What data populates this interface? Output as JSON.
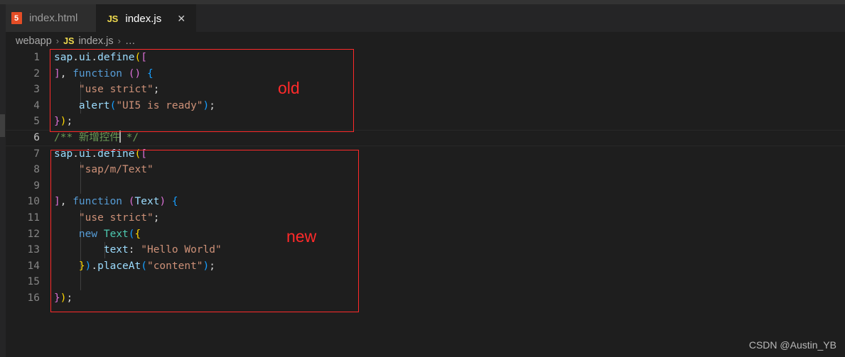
{
  "window": {
    "background": "#1e1e1e",
    "accent_red": "#ff2a2a"
  },
  "tabs": [
    {
      "label": "index.html",
      "icon": "html5-file-icon",
      "icon_glyph": "5",
      "active": false,
      "closable": false
    },
    {
      "label": "index.js",
      "icon": "javascript-file-icon",
      "icon_glyph": "JS",
      "active": true,
      "closable": true,
      "close_glyph": "✕"
    }
  ],
  "breadcrumb": {
    "root": "webapp",
    "separator": "›",
    "file_icon": "JS",
    "file": "index.js",
    "more": "…"
  },
  "editor": {
    "language": "javascript",
    "active_line": 6,
    "lines": [
      {
        "n": "1",
        "active": false,
        "guides": []
      },
      {
        "n": "2",
        "active": false,
        "guides": []
      },
      {
        "n": "3",
        "active": false,
        "guides": [
          "g1"
        ]
      },
      {
        "n": "4",
        "active": false,
        "guides": [
          "g1"
        ]
      },
      {
        "n": "5",
        "active": false,
        "guides": []
      },
      {
        "n": "6",
        "active": true,
        "guides": []
      },
      {
        "n": "7",
        "active": false,
        "guides": []
      },
      {
        "n": "8",
        "active": false,
        "guides": [
          "g1"
        ]
      },
      {
        "n": "9",
        "active": false,
        "guides": [
          "g1"
        ]
      },
      {
        "n": "10",
        "active": false,
        "guides": []
      },
      {
        "n": "11",
        "active": false,
        "guides": [
          "g1"
        ]
      },
      {
        "n": "12",
        "active": false,
        "guides": [
          "g1"
        ]
      },
      {
        "n": "13",
        "active": false,
        "guides": [
          "g1",
          "g2"
        ]
      },
      {
        "n": "14",
        "active": false,
        "guides": [
          "g1"
        ]
      },
      {
        "n": "15",
        "active": false,
        "guides": [
          "g1"
        ]
      },
      {
        "n": "16",
        "active": false,
        "guides": []
      }
    ],
    "code_text": {
      "l1": "sap.ui.define([",
      "l2": "], function () {",
      "l3": "    \"use strict\";",
      "l4": "    alert(\"UI5 is ready\");",
      "l5": "});",
      "l6": "/** 新增控件 */",
      "l7": "sap.ui.define([",
      "l8": "    \"sap/m/Text\"",
      "l9": "",
      "l10": "], function (Text) {",
      "l11": "    \"use strict\";",
      "l12": "    new Text({",
      "l13": "        text: \"Hello World\"",
      "l14": "    }).placeAt(\"content\");",
      "l15": "",
      "l16": "});"
    },
    "tokens": {
      "sap": "sap",
      "dot": ".",
      "ui": "ui",
      "define": "define",
      "lparen": "(",
      "lbracket": "[",
      "rbracket": "]",
      "comma": ",",
      "function": "function",
      "sp": " ",
      "emptyparens": "()",
      "lbrace": "{",
      "rbrace": "}",
      "rparen": ")",
      "semi": ";",
      "use_strict": "\"use strict\"",
      "alert": "alert",
      "ui5_is_ready": "\"UI5 is ready\"",
      "comment_open": "/** ",
      "comment_cn": "新增控件",
      "comment_close": " */",
      "sap_m_text": "\"sap/m/Text\"",
      "text_param": "Text",
      "new": "new",
      "Text": "Text",
      "text_prop": "text",
      "colon": ":",
      "hello_world": "\"Hello World\"",
      "placeAt": "placeAt",
      "content": "\"content\"",
      "indent4": "    ",
      "indent8": "        "
    },
    "syntax_colors": {
      "variable": "#9cdcfe",
      "keyword": "#569cd6",
      "class": "#4ec9b0",
      "string": "#ce9178",
      "comment": "#6a9955",
      "plain": "#d4d4d4",
      "bracket_level1": "#ffd700",
      "bracket_level2": "#da70d6",
      "bracket_level3": "#179fff"
    }
  },
  "annotations": [
    {
      "id": "old",
      "label": "old",
      "color": "#ff2a2a"
    },
    {
      "id": "new",
      "label": "new",
      "color": "#ff2a2a"
    }
  ],
  "watermark": {
    "text": "CSDN @Austin_YB"
  }
}
